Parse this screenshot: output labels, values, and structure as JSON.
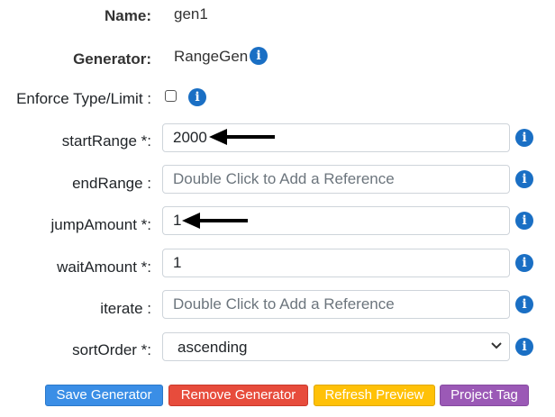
{
  "form": {
    "name_label": "Name:",
    "name_value": "gen1",
    "generator_label": "Generator:",
    "generator_value": "RangeGen",
    "enforce_label": "Enforce Type/Limit :",
    "enforce_checked": false,
    "start_range_label": "startRange *:",
    "start_range_value": "2000",
    "end_range_label": "endRange :",
    "end_range_placeholder": "Double Click to Add a Reference",
    "jump_amount_label": "jumpAmount *:",
    "jump_amount_value": "1",
    "wait_amount_label": "waitAmount *:",
    "wait_amount_value": "1",
    "iterate_label": "iterate :",
    "iterate_placeholder": "Double Click to Add a Reference",
    "sort_order_label": "sortOrder *:",
    "sort_order_value": "ascending",
    "info_icon_glyph": "i"
  },
  "buttons": {
    "save": "Save Generator",
    "remove": "Remove Generator",
    "refresh": "Refresh Preview",
    "project_tag": "Project Tag"
  },
  "colors": {
    "info_icon": "#1a6fc4",
    "save_button": "#3a8ee6",
    "remove_button": "#e74c3c",
    "refresh_button": "#ffc107",
    "project_tag_button": "#9b59b6"
  },
  "icons": [
    "info-icon",
    "arrow-left-icon",
    "chevron-down-icon",
    "checkbox"
  ]
}
